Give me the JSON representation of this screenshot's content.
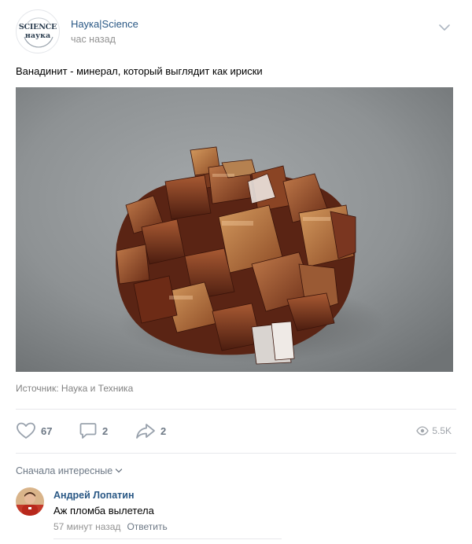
{
  "post": {
    "group_name": "Наука|Science",
    "time": "час назад",
    "logo_line1": "SCIENCE",
    "logo_line2": "наука",
    "text": "Ванадинит - минерал, который выглядит как ириски",
    "source": "Источник: Наука и Техника"
  },
  "actions": {
    "likes": "67",
    "comments": "2",
    "shares": "2",
    "views": "5.5K",
    "icons": [
      "heart-icon",
      "comment-icon",
      "share-icon",
      "eye-icon"
    ]
  },
  "comments_section": {
    "sort_label": "Сначала интересные",
    "items": [
      {
        "author": "Андрей Лопатин",
        "text": "Аж пломба вылетела",
        "time": "57 минут назад",
        "reply_label": "Ответить"
      }
    ]
  },
  "colors": {
    "link": "#2a5885",
    "muted": "#939393",
    "divider": "#e7e8ec"
  }
}
